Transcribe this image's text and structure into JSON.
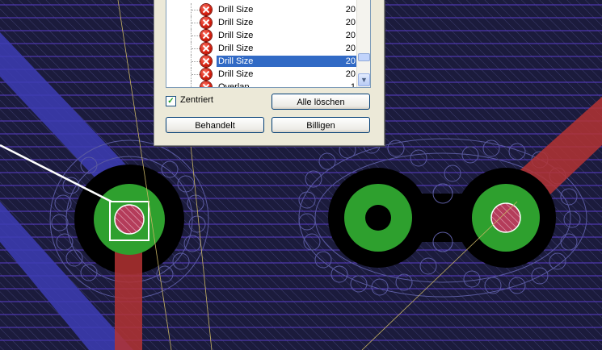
{
  "dialog": {
    "rows": [
      {
        "label": "Drill Size",
        "value": "20",
        "selected": false,
        "icon": "error-icon"
      },
      {
        "label": "Drill Size",
        "value": "20",
        "selected": false,
        "icon": "error-icon"
      },
      {
        "label": "Drill Size",
        "value": "20",
        "selected": false,
        "icon": "error-icon"
      },
      {
        "label": "Drill Size",
        "value": "20",
        "selected": false,
        "icon": "error-icon"
      },
      {
        "label": "Drill Size",
        "value": "20",
        "selected": true,
        "icon": "error-icon"
      },
      {
        "label": "Drill Size",
        "value": "20",
        "selected": false,
        "icon": "error-icon"
      },
      {
        "label": "Overlap",
        "value": "1",
        "selected": false,
        "icon": "error-icon"
      }
    ],
    "checkbox": {
      "label": "Zentriert",
      "checked": true
    },
    "buttons": {
      "clear_all": "Alle löschen",
      "handled": "Behandelt",
      "approve": "Billigen"
    }
  },
  "colors": {
    "board_bg": "#1b1b3c",
    "hatch": "#5a3cc8",
    "copper_blue": "#3c3cb4",
    "copper_red": "#b43232",
    "pad_green": "#2ea02e",
    "selection": "#316ac5"
  }
}
